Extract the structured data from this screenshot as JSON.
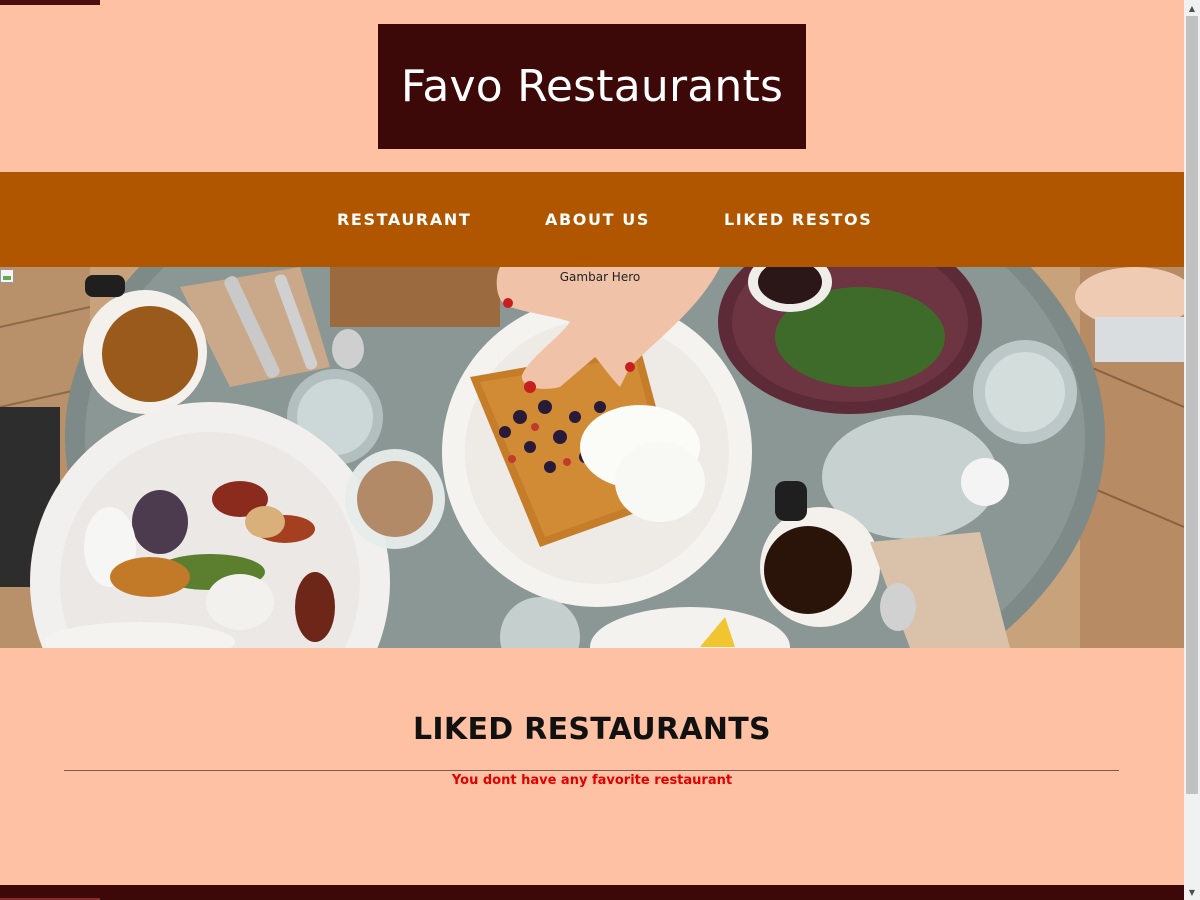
{
  "header": {
    "brand_title": "Favo Restaurants"
  },
  "nav": {
    "items": [
      {
        "label": "RESTAURANT"
      },
      {
        "label": "ABOUT US"
      },
      {
        "label": "LIKED RESTOS"
      }
    ]
  },
  "hero": {
    "alt_text": "Gambar Hero"
  },
  "main": {
    "title": "LIKED RESTAURANTS",
    "empty_message": "You dont have any favorite restaurant"
  },
  "colors": {
    "page_background": "#ffc1a4",
    "brand_box": "#3d0808",
    "nav_background": "#b05600",
    "empty_message": "#e00000"
  },
  "icons": {
    "scroll_up": "triangle-up",
    "scroll_down": "triangle-down",
    "broken_image": "broken-image-icon"
  }
}
